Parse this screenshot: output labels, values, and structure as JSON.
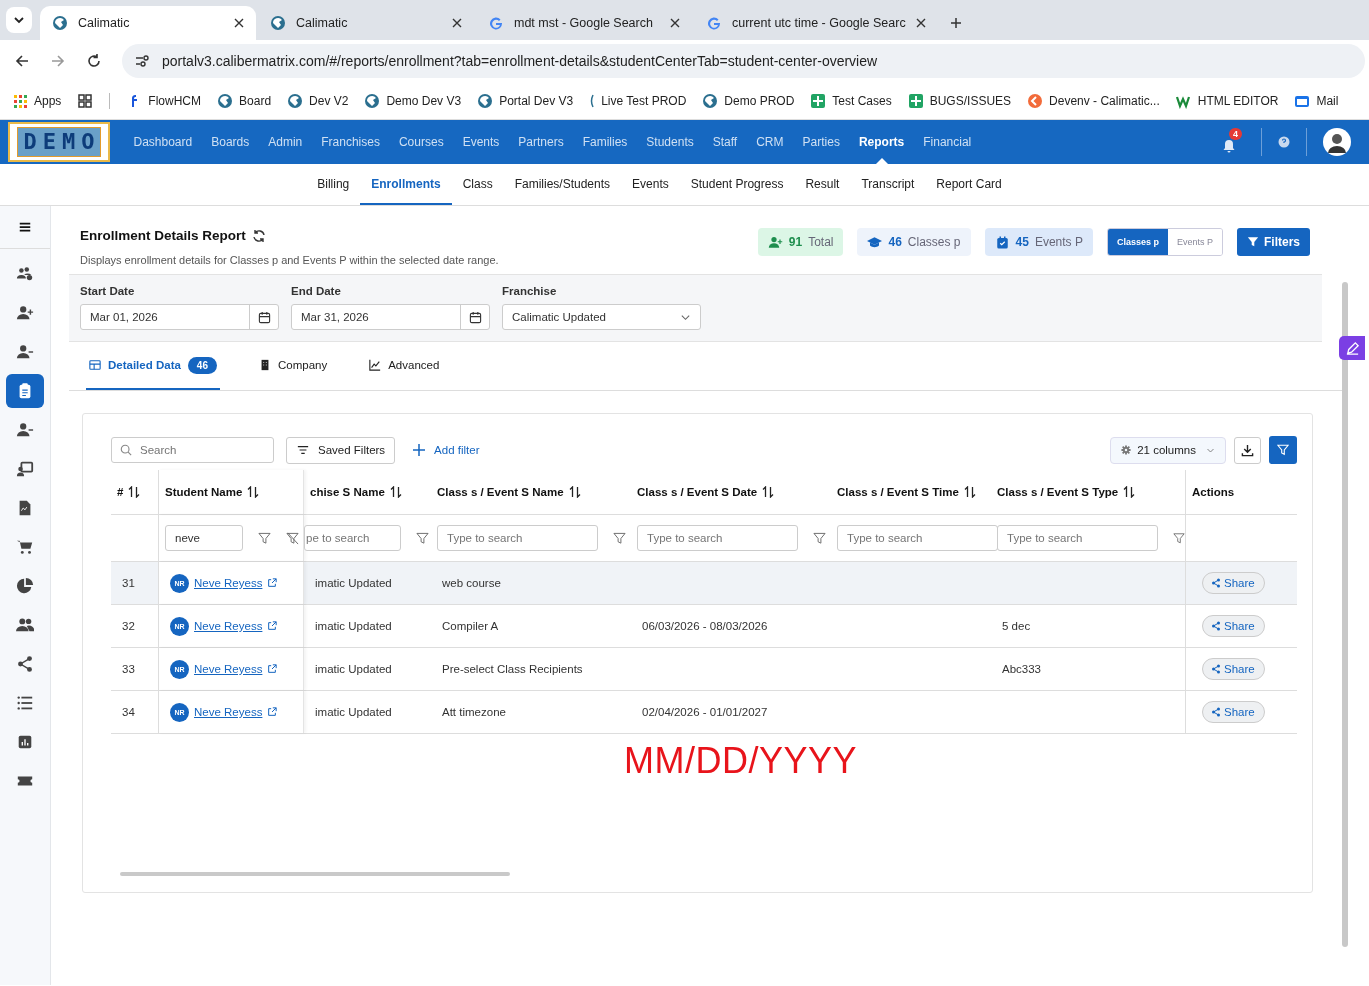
{
  "browser": {
    "tabs": [
      {
        "title": "Calimatic",
        "kind": "globe",
        "selected": true
      },
      {
        "title": "Calimatic",
        "kind": "globe",
        "selected": false
      },
      {
        "title": "mdt mst - Google Search",
        "kind": "google",
        "selected": false
      },
      {
        "title": "current utc time - Google Searc",
        "kind": "google",
        "selected": false
      }
    ],
    "url": "portalv3.calibermatrix.com/#/reports/enrollment?tab=enrollment-details&studentCenterTab=student-center-overview",
    "bookmarks": [
      {
        "label": "Apps",
        "kind": "apps"
      },
      {
        "label": "FlowHCM",
        "kind": "flow"
      },
      {
        "label": "Board",
        "kind": "globe"
      },
      {
        "label": "Dev V2",
        "kind": "globe"
      },
      {
        "label": "Demo Dev V3",
        "kind": "globe"
      },
      {
        "label": "Portal Dev V3",
        "kind": "globe"
      },
      {
        "label": "Live Test PROD",
        "kind": "sliver"
      },
      {
        "label": "Demo PROD",
        "kind": "globe"
      },
      {
        "label": "Test Cases",
        "kind": "sheet"
      },
      {
        "label": "BUGS/ISSUES",
        "kind": "sheet"
      },
      {
        "label": "Devenv - Calimatic...",
        "kind": "devenv"
      },
      {
        "label": "HTML EDITOR",
        "kind": "w"
      },
      {
        "label": "Mail",
        "kind": "mail"
      }
    ]
  },
  "app": {
    "logo": "DEMO",
    "nav": [
      {
        "label": "Dashboard",
        "selected": false
      },
      {
        "label": "Boards",
        "selected": false
      },
      {
        "label": "Admin",
        "selected": false
      },
      {
        "label": "Franchises",
        "selected": false
      },
      {
        "label": "Courses",
        "selected": false
      },
      {
        "label": "Events",
        "selected": false
      },
      {
        "label": "Partners",
        "selected": false
      },
      {
        "label": "Families",
        "selected": false
      },
      {
        "label": "Students",
        "selected": false
      },
      {
        "label": "Staff",
        "selected": false
      },
      {
        "label": "CRM",
        "selected": false
      },
      {
        "label": "Parties",
        "selected": false
      },
      {
        "label": "Reports",
        "selected": true
      },
      {
        "label": "Financial",
        "selected": false
      }
    ],
    "notification_count": "4",
    "subnav": [
      {
        "label": "Billing",
        "selected": false
      },
      {
        "label": "Enrollments",
        "selected": true
      },
      {
        "label": "Class",
        "selected": false
      },
      {
        "label": "Families/Students",
        "selected": false
      },
      {
        "label": "Events",
        "selected": false
      },
      {
        "label": "Student Progress",
        "selected": false
      },
      {
        "label": "Result",
        "selected": false
      },
      {
        "label": "Transcript",
        "selected": false
      },
      {
        "label": "Report Card",
        "selected": false
      }
    ],
    "sidebar": [
      {
        "kind": "users-gear",
        "selected": false
      },
      {
        "kind": "user-plus",
        "selected": false
      },
      {
        "kind": "user-minus",
        "selected": false
      },
      {
        "kind": "clipboard",
        "selected": true
      },
      {
        "kind": "user-minus",
        "selected": false
      },
      {
        "kind": "presenter",
        "selected": false
      },
      {
        "kind": "document",
        "selected": false
      },
      {
        "kind": "cart",
        "selected": false
      },
      {
        "kind": "pie",
        "selected": false
      },
      {
        "kind": "users",
        "selected": false
      },
      {
        "kind": "share",
        "selected": false
      },
      {
        "kind": "list",
        "selected": false
      },
      {
        "kind": "chart",
        "selected": false
      },
      {
        "kind": "ticket",
        "selected": false
      }
    ]
  },
  "report": {
    "title": "Enrollment Details Report",
    "description": "Displays enrollment details for Classes p and Events P within the selected date range.",
    "stats": [
      {
        "kind": "total",
        "count": "91",
        "label": "Total"
      },
      {
        "kind": "classes",
        "count": "46",
        "label": "Classes p"
      },
      {
        "kind": "events",
        "count": "45",
        "label": "Events P"
      }
    ],
    "view_toggle": [
      {
        "label": "Classes p",
        "selected": true
      },
      {
        "label": "Events P",
        "selected": false
      }
    ],
    "filters_button": "Filters",
    "fields": [
      {
        "kind": "date",
        "label": "Start Date",
        "value": "Mar 01, 2026"
      },
      {
        "kind": "date",
        "label": "End Date",
        "value": "Mar 31, 2026"
      },
      {
        "kind": "select",
        "label": "Franchise",
        "value": "Calimatic Updated"
      }
    ],
    "data_tabs": [
      {
        "label": "Detailed Data",
        "kind": "table",
        "badge": "46",
        "selected": true
      },
      {
        "label": "Company",
        "kind": "building",
        "selected": false
      },
      {
        "label": "Advanced",
        "kind": "chart",
        "selected": false
      }
    ],
    "toolbar": {
      "search_placeholder": "Search",
      "saved_filters": "Saved Filters",
      "add_filter": "Add filter",
      "columns": "21 columns"
    },
    "table": {
      "columns": [
        {
          "label": "#",
          "sortable": true
        },
        {
          "label": "Student Name",
          "sortable": true,
          "filter_value": "neve",
          "clear_filter": true
        },
        {
          "label": "chise S Name",
          "sortable": true,
          "filter_placeholder": "pe to search"
        },
        {
          "label": "Class s / Event S Name",
          "sortable": true,
          "filter_placeholder": "Type to search"
        },
        {
          "label": "Class s / Event S Date",
          "sortable": true,
          "filter_placeholder": "Type to search"
        },
        {
          "label": "Class s / Event S Time",
          "sortable": true,
          "filter_placeholder": "Type to search"
        },
        {
          "label": "Class s / Event S Type",
          "sortable": true,
          "filter_placeholder": "Type to search"
        },
        {
          "label": "Actions",
          "sortable": false
        }
      ],
      "rows": [
        {
          "number": "31",
          "initials": "NR",
          "student": "Neve Reyess",
          "franchise": "imatic Updated",
          "name": "web course",
          "date": "",
          "time": "",
          "type": "",
          "action": "Share",
          "highlighted": true
        },
        {
          "number": "32",
          "initials": "NR",
          "student": "Neve Reyess",
          "franchise": "imatic Updated",
          "name": "Compiler A",
          "date": "06/03/2026 - 08/03/2026",
          "time": "",
          "type": "5 dec",
          "action": "Share",
          "highlighted": false
        },
        {
          "number": "33",
          "initials": "NR",
          "student": "Neve Reyess",
          "franchise": "imatic Updated",
          "name": "Pre-select Class Recipients",
          "date": "",
          "time": "",
          "type": "Abc333",
          "action": "Share",
          "highlighted": false
        },
        {
          "number": "34",
          "initials": "NR",
          "student": "Neve Reyess",
          "franchise": "imatic Updated",
          "name": "Att timezone",
          "date": "02/04/2026 - 01/01/2027",
          "time": "",
          "type": "",
          "action": "Share",
          "highlighted": false
        }
      ]
    }
  },
  "annotation": "MM/DD/YYYY"
}
